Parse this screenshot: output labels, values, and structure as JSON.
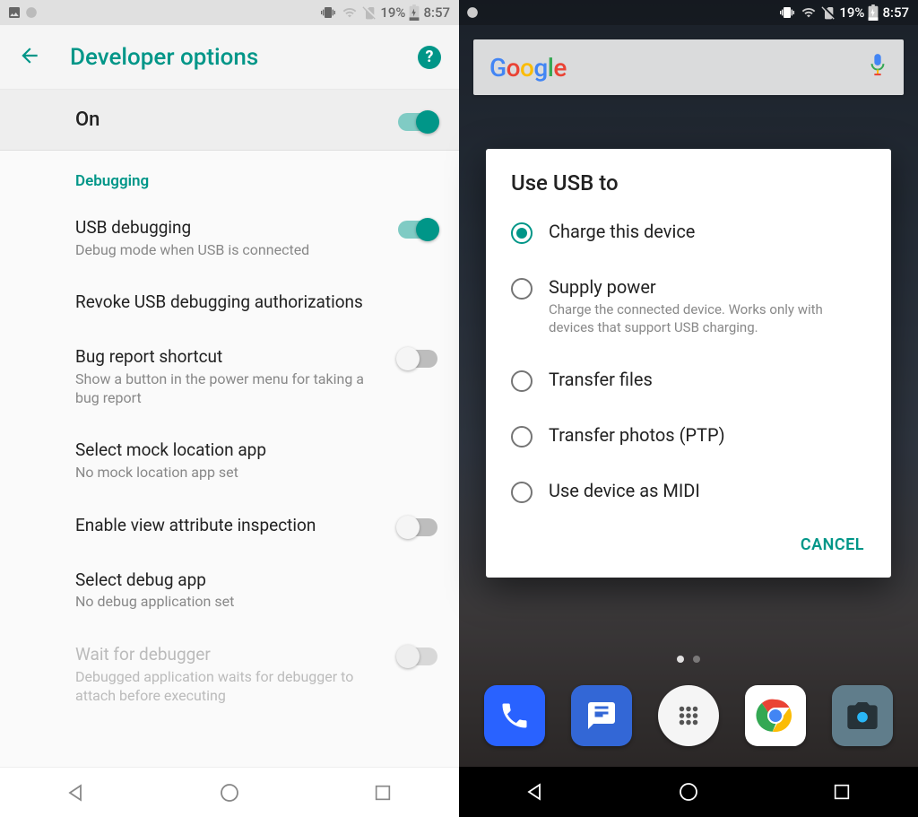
{
  "status": {
    "battery": "19%",
    "time": "8:57"
  },
  "left": {
    "title": "Developer options",
    "master_label": "On",
    "section_header": "Debugging",
    "items": [
      {
        "title": "USB debugging",
        "subtitle": "Debug mode when USB is connected",
        "toggle": "on"
      },
      {
        "title": "Revoke USB debugging authorizations",
        "subtitle": ""
      },
      {
        "title": "Bug report shortcut",
        "subtitle": "Show a button in the power menu for taking a bug report",
        "toggle": "off"
      },
      {
        "title": "Select mock location app",
        "subtitle": "No mock location app set"
      },
      {
        "title": "Enable view attribute inspection",
        "subtitle": "",
        "toggle": "off"
      },
      {
        "title": "Select debug app",
        "subtitle": "No debug application set"
      },
      {
        "title": "Wait for debugger",
        "subtitle": "Debugged application waits for debugger to attach before executing",
        "toggle": "off",
        "disabled": true
      }
    ]
  },
  "right": {
    "search_placeholder": "Google",
    "dialog": {
      "title": "Use USB to",
      "options": [
        {
          "label": "Charge this device",
          "desc": "",
          "selected": true
        },
        {
          "label": "Supply power",
          "desc": "Charge the connected device. Works only with devices that support USB charging."
        },
        {
          "label": "Transfer files",
          "desc": ""
        },
        {
          "label": "Transfer photos (PTP)",
          "desc": ""
        },
        {
          "label": "Use device as MIDI",
          "desc": ""
        }
      ],
      "cancel": "CANCEL"
    }
  }
}
